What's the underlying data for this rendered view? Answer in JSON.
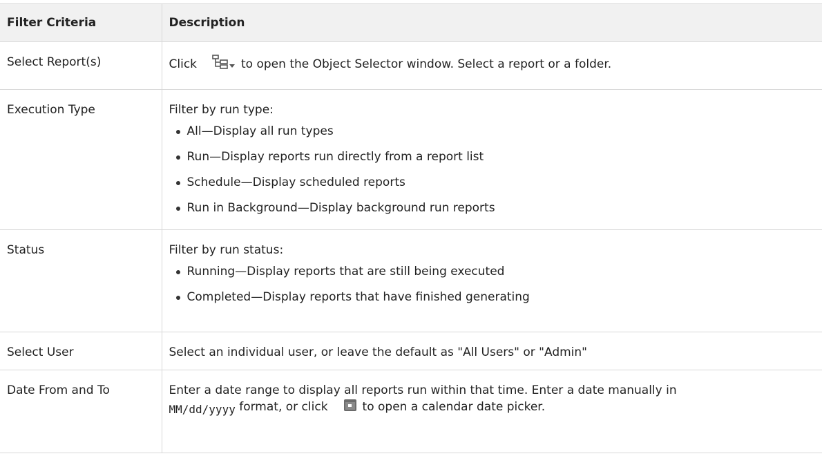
{
  "table": {
    "headers": {
      "criteria": "Filter Criteria",
      "description": "Description"
    },
    "select_report": {
      "criteria": "Select Report(s)",
      "desc_before": "Click",
      "desc_after": "to open the Object Selector window. Select a report or a folder.",
      "icon": "object-selector-icon"
    },
    "execution_type": {
      "criteria": "Execution Type",
      "intro": "Filter by run type:",
      "items": [
        "All—Display all run types",
        "Run—Display reports run directly from a report list",
        "Schedule—Display scheduled reports",
        "Run in Background—Display background run reports"
      ]
    },
    "status": {
      "criteria": "Status",
      "intro": "Filter by run status:",
      "items": [
        "Running—Display reports that are still being executed",
        "Completed—Display reports that have finished generating"
      ]
    },
    "select_user": {
      "criteria": "Select User",
      "description": "Select an individual user, or leave the default as \"All Users\" or \"Admin\""
    },
    "date_range": {
      "criteria": "Date From and To",
      "line1": "Enter a date range to display all reports run within that time. Enter a date manually in",
      "format": "MM/dd/yyyy",
      "desc_mid": "format, or click",
      "desc_end": "to open a calendar date picker.",
      "icon": "calendar-icon"
    }
  },
  "colors": {
    "header_bg": "#f1f1f1",
    "border": "#d8d8d8",
    "text": "#222222"
  }
}
